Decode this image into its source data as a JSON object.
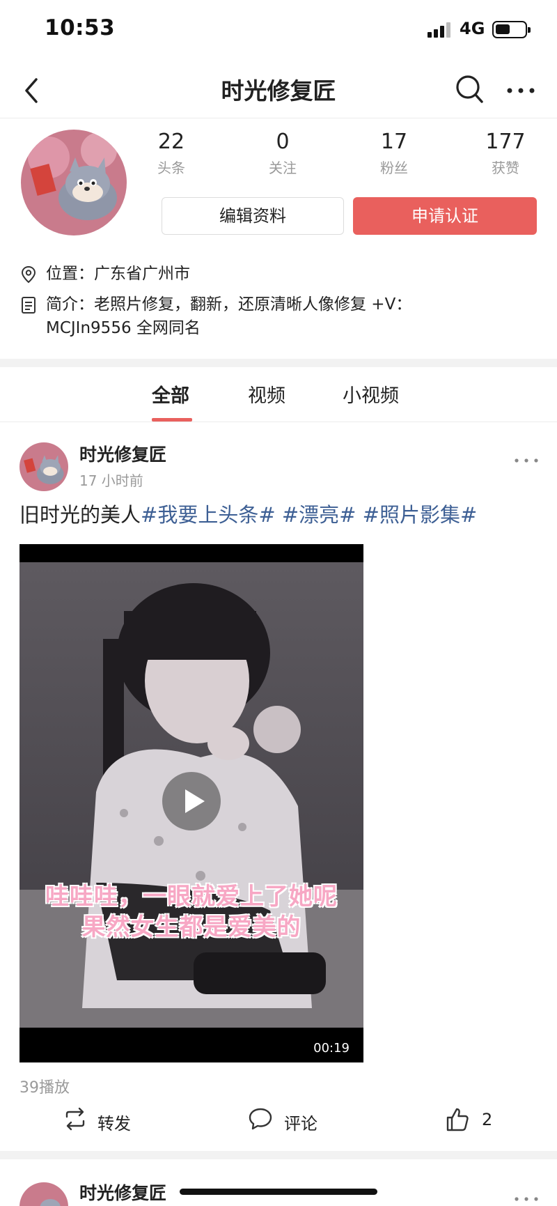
{
  "status_bar": {
    "time": "10:53",
    "network": "4G"
  },
  "nav": {
    "title": "时光修复匠"
  },
  "profile": {
    "stats": [
      {
        "value": "22",
        "label": "头条"
      },
      {
        "value": "0",
        "label": "关注"
      },
      {
        "value": "17",
        "label": "粉丝"
      },
      {
        "value": "177",
        "label": "获赞"
      }
    ],
    "edit_button": "编辑资料",
    "verify_button": "申请认证",
    "location": "位置：广东省广州市",
    "bio_line1": "简介：老照片修复，翻新，还原清晰人像修复 +V：",
    "bio_line2": "MCJIn9556 全网同名"
  },
  "tabs": [
    "全部",
    "视频",
    "小视频"
  ],
  "post": {
    "author": "时光修复匠",
    "time": "17 小时前",
    "text_plain": "旧时光的美人",
    "text_tags": "#我要上头条# #漂亮# #照片影集#",
    "video_subtitle_1": "哇哇哇，一眼就爱上了她呢",
    "video_subtitle_2": "果然女生都是爱美的",
    "duration": "00:19",
    "plays": "39播放",
    "actions": {
      "share": "转发",
      "comment": "评论",
      "like_count": "2"
    }
  },
  "post2": {
    "author": "时光修复匠"
  },
  "colors": {
    "accent": "#e9605d",
    "tag": "#3d5f94",
    "muted": "#9a9a9a"
  }
}
